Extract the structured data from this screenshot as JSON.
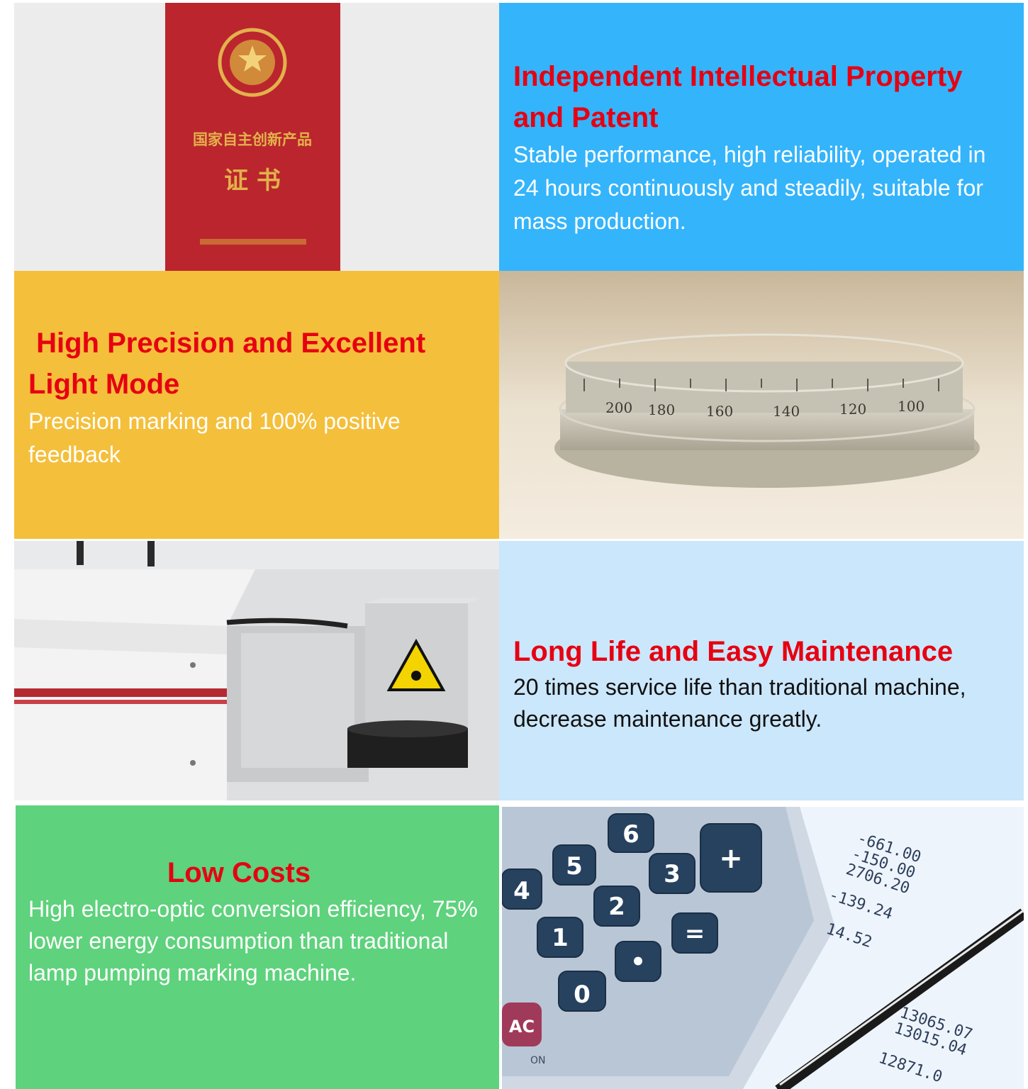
{
  "features": [
    {
      "title": "Independent Intellectual Property and Patent",
      "description": "Stable performance, high reliability, operated in 24 hours continuously and steadily, suitable for mass production."
    },
    {
      "title": " High Precision and Excellent Light Mode",
      "description": "Precision marking and 100% positive feedback"
    },
    {
      "title": "Long Life and Easy Maintenance",
      "description": "20 times service life than traditional machine, decrease maintenance greatly."
    },
    {
      "title": "Low Costs",
      "description": "High electro-optic conversion efficiency, 75% lower energy consumption than traditional lamp pumping marking machine."
    }
  ],
  "images": {
    "certificate": {
      "line1": "国家自主创新产品",
      "line2": "证 书"
    },
    "dial": {
      "ticks": [
        "200",
        "180",
        "160",
        "140",
        "120",
        "100"
      ]
    },
    "calculator": {
      "keys": [
        "6",
        "5",
        "4",
        "3",
        "2",
        "1",
        "0",
        "+",
        "=",
        "•",
        "AC"
      ],
      "on_label": "ON",
      "receipt_numbers": [
        "-661.00",
        "-150.00",
        "2706.20",
        "-139.24",
        "14.52",
        "13065.07",
        "13015.04",
        "12871.0"
      ]
    }
  },
  "colors": {
    "heading": "#e60012",
    "blue_tile": "#34b4fb",
    "yellow_tile": "#f4bf3b",
    "light_blue_tile": "#cbe7fb",
    "green_tile": "#5ed27c"
  }
}
